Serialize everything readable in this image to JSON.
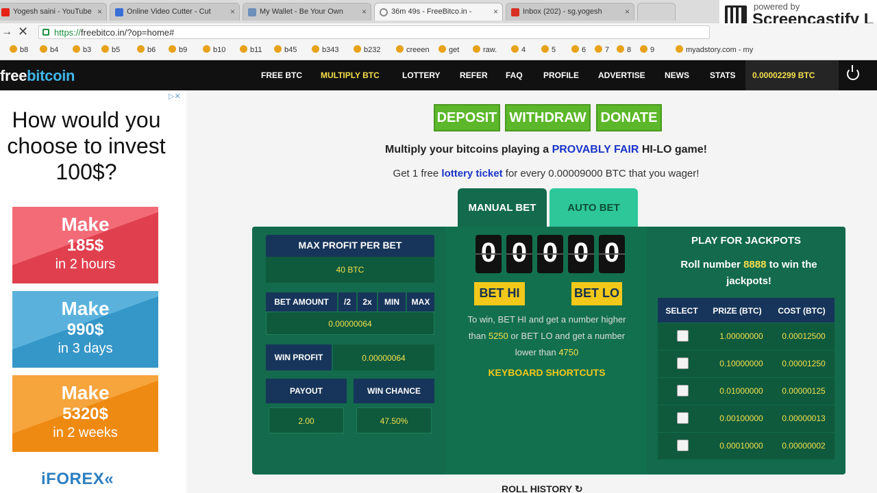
{
  "browser": {
    "tabs": [
      {
        "title": "Yogesh saini - YouTube",
        "active": false
      },
      {
        "title": "Online Video Cutter - Cut",
        "active": false
      },
      {
        "title": "My Wallet - Be Your Own",
        "active": false
      },
      {
        "title": "36m 49s - FreeBitco.in - ",
        "active": true
      },
      {
        "title": "Inbox (202) - sg.yogesh",
        "active": false
      }
    ],
    "url_scheme": "https://",
    "url_rest": "freebitco.in/?op=home#",
    "bookmarks": [
      "b8",
      "b4",
      "b3",
      "b5",
      "b6",
      "b9",
      "b10",
      "b11",
      "b45",
      "b343",
      "b232",
      "creeen",
      "get",
      "raw.",
      "4",
      "5",
      "6",
      "7",
      "8",
      "9",
      "myadstory.com - my"
    ]
  },
  "screencastify": {
    "small": "powered by",
    "big": "Screencastify L"
  },
  "site": {
    "logo_a": "free",
    "logo_b": "bitcoin",
    "nav": [
      "FREE BTC",
      "MULTIPLY BTC",
      "LOTTERY",
      "REFER",
      "FAQ",
      "PROFILE",
      "ADVERTISE",
      "NEWS",
      "STATS"
    ],
    "active_nav": "MULTIPLY BTC",
    "balance": "0.00002299 BTC"
  },
  "ad": {
    "title": "How would you choose to invest 100$?",
    "boxes": [
      {
        "l1": "Make",
        "l2": "185$",
        "l3": "in 2 hours"
      },
      {
        "l1": "Make",
        "l2": "990$",
        "l3": "in 3 days"
      },
      {
        "l1": "Make",
        "l2": "5320$",
        "l3": "in 2 weeks"
      }
    ],
    "brand": "iFOREX",
    "brand_mark": "«"
  },
  "main": {
    "deposit": "DEPOSIT",
    "withdraw": "WITHDRAW",
    "donate": "DONATE",
    "headline_pre": "Multiply your bitcoins playing a ",
    "headline_hl": "PROVABLY FAIR",
    "headline_post": " HI-LO game!",
    "sub_pre": "Get 1 free ",
    "sub_hl": "lottery ticket",
    "sub_post": " for every 0.00009000 BTC that you wager!",
    "tab_manual": "MANUAL BET",
    "tab_auto": "AUTO BET",
    "max_profit_label": "MAX PROFIT PER BET",
    "max_profit_value": "40 BTC",
    "bet_amount_label": "BET AMOUNT",
    "bet_controls": [
      "/2",
      "2x",
      "MIN",
      "MAX"
    ],
    "bet_amount_value": "0.00000064",
    "win_profit_label": "WIN PROFIT",
    "win_profit_value": "0.00000064",
    "payout_label": "PAYOUT",
    "payout_value": "2.00",
    "win_chance_label": "WIN CHANCE",
    "win_chance_value": "47.50%",
    "digits": [
      "0",
      "0",
      "0",
      "0",
      "0"
    ],
    "bet_hi": "BET HI",
    "bet_lo": "BET LO",
    "rules_1": "To win, BET HI and get a number higher",
    "rules_2_pre": "than ",
    "rules_2_num": "5250",
    "rules_2_post": " or BET LO and get a number",
    "rules_3_pre": "lower than ",
    "rules_3_num": "4750",
    "keyboard_shortcuts": "KEYBOARD SHORTCUTS",
    "jackpot_title": "PLAY FOR JACKPOTS",
    "jackpot_sub_pre": "Roll number ",
    "jackpot_sub_num": "8888",
    "jackpot_sub_post": " to win the jackpots!",
    "jackpot_headers": [
      "SELECT",
      "PRIZE (BTC)",
      "COST (BTC)"
    ],
    "jackpots": [
      {
        "prize": "1.00000000",
        "cost": "0.00012500"
      },
      {
        "prize": "0.10000000",
        "cost": "0.00001250"
      },
      {
        "prize": "0.01000000",
        "cost": "0.00000125"
      },
      {
        "prize": "0.00100000",
        "cost": "0.00000013"
      },
      {
        "prize": "0.00010000",
        "cost": "0.00000002"
      }
    ],
    "roll_history": "ROLL HISTORY ↻"
  }
}
